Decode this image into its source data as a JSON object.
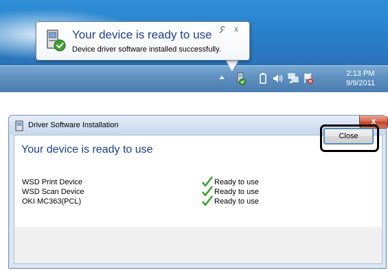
{
  "notification": {
    "title": "Your device is ready to use",
    "body": "Device driver software installed successfully.",
    "close_glyph": "x",
    "icons": {
      "device": "device-installed-icon",
      "options": "wrench-icon",
      "close": "close-icon"
    }
  },
  "taskbar": {
    "time": "2:13 PM",
    "date": "9/9/2011",
    "tray_icons": [
      "show-hidden-icons",
      "device-install-icon",
      "battery-icon",
      "volume-icon",
      "network-icon",
      "action-center-icon"
    ]
  },
  "dialog": {
    "window_title": "Driver Software Installation",
    "close_glyph": "x",
    "heading": "Your device is ready to use",
    "devices": [
      {
        "name": "WSD Print Device",
        "status": "Ready to use"
      },
      {
        "name": "WSD Scan Device",
        "status": "Ready to use"
      },
      {
        "name": "OKI MC363(PCL)",
        "status": "Ready to use"
      }
    ],
    "close_button": "Close"
  },
  "colors": {
    "accent_title": "#1e3f8f",
    "check_green": "#3aa22f",
    "desktop_blue": "#2a7fc9"
  }
}
